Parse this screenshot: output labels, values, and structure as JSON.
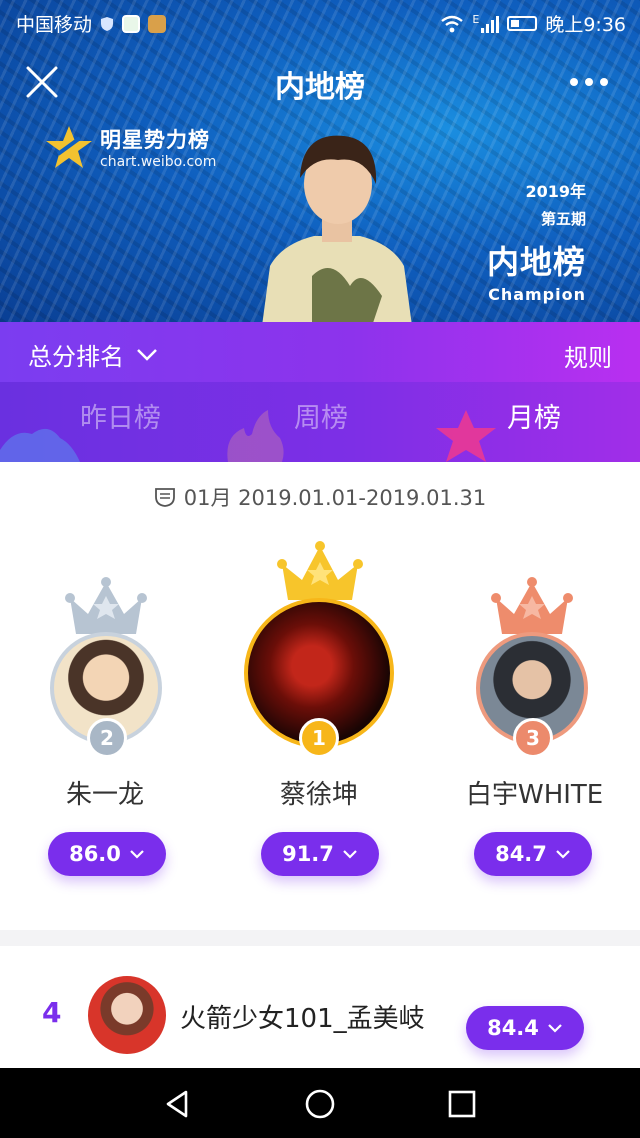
{
  "status_bar": {
    "carrier": "中国移动",
    "network": "E",
    "time": "晚上9:36"
  },
  "header": {
    "title": "内地榜",
    "logo_title": "明星势力榜",
    "logo_url": "chart.weibo.com",
    "year": "2019年",
    "issue": "第五期",
    "board_name": "内地榜",
    "board_sub": "Champion"
  },
  "ranking": {
    "selector_label": "总分排名",
    "rules_label": "规则",
    "tabs": [
      {
        "label": "昨日榜",
        "active": false
      },
      {
        "label": "周榜",
        "active": false
      },
      {
        "label": "月榜",
        "active": true
      }
    ],
    "date_range": "01月 2019.01.01-2019.01.31"
  },
  "podium": [
    {
      "rank": "2",
      "name": "朱一龙",
      "score": "86.0",
      "color": "#a9b7c6"
    },
    {
      "rank": "1",
      "name": "蔡徐坤",
      "score": "91.7",
      "color": "#f7b619"
    },
    {
      "rank": "3",
      "name": "白宇WHITE",
      "score": "84.7",
      "color": "#ec8a6c"
    }
  ],
  "list": [
    {
      "rank": "4",
      "name": "火箭少女101_孟美岐",
      "score": "84.4"
    }
  ],
  "colors": {
    "accent_purple": "#7a2eec",
    "gold": "#f7b619",
    "silver": "#a9b7c6",
    "bronze": "#ec8a6c"
  }
}
